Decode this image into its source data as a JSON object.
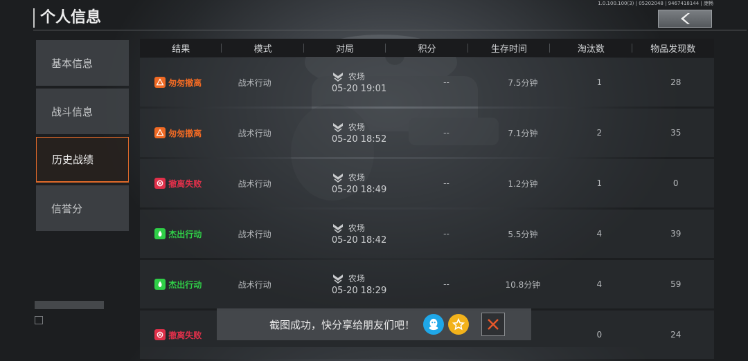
{
  "header": {
    "title": "个人信息",
    "build_info": "1.0.100.100(3) | 05202048 | 9467418144 | 庞畅"
  },
  "sidebar": {
    "items": [
      {
        "label": "基本信息"
      },
      {
        "label": "战斗信息"
      },
      {
        "label": "历史战绩",
        "active": true
      },
      {
        "label": "信誉分"
      }
    ]
  },
  "table": {
    "columns": [
      "结果",
      "模式",
      "对局",
      "积分",
      "生存时间",
      "淘汰数",
      "物品发现数"
    ],
    "rows": [
      {
        "result": "匆匆撤离",
        "result_type": "hasty",
        "mode": "战术行动",
        "map": "农场",
        "time": "05-20 19:01",
        "score": "--",
        "survival": "7.5分钟",
        "kills": "1",
        "items": "28"
      },
      {
        "result": "匆匆撤离",
        "result_type": "hasty",
        "mode": "战术行动",
        "map": "农场",
        "time": "05-20 18:52",
        "score": "--",
        "survival": "7.1分钟",
        "kills": "2",
        "items": "35"
      },
      {
        "result": "撤离失败",
        "result_type": "failed",
        "mode": "战术行动",
        "map": "农场",
        "time": "05-20 18:49",
        "score": "--",
        "survival": "1.2分钟",
        "kills": "1",
        "items": "0"
      },
      {
        "result": "杰出行动",
        "result_type": "outstanding",
        "mode": "战术行动",
        "map": "农场",
        "time": "05-20 18:42",
        "score": "--",
        "survival": "5.5分钟",
        "kills": "4",
        "items": "39"
      },
      {
        "result": "杰出行动",
        "result_type": "outstanding",
        "mode": "战术行动",
        "map": "农场",
        "time": "05-20 18:29",
        "score": "--",
        "survival": "10.8分钟",
        "kills": "4",
        "items": "59"
      },
      {
        "result": "撤离失败",
        "result_type": "failed",
        "mode": "",
        "map": "",
        "time": "",
        "score": "",
        "survival": "",
        "kills": "0",
        "items": "24"
      }
    ]
  },
  "toast": {
    "text": "截图成功，快分享给朋友们吧！",
    "qq_icon": "qq-icon",
    "qzone_icon": "qzone-star-icon",
    "close_icon": "close-icon"
  },
  "colors": {
    "hasty": "#f06a24",
    "failed": "#e0304a",
    "outstanding": "#2fcf47",
    "active_border": "#e06a2a"
  }
}
